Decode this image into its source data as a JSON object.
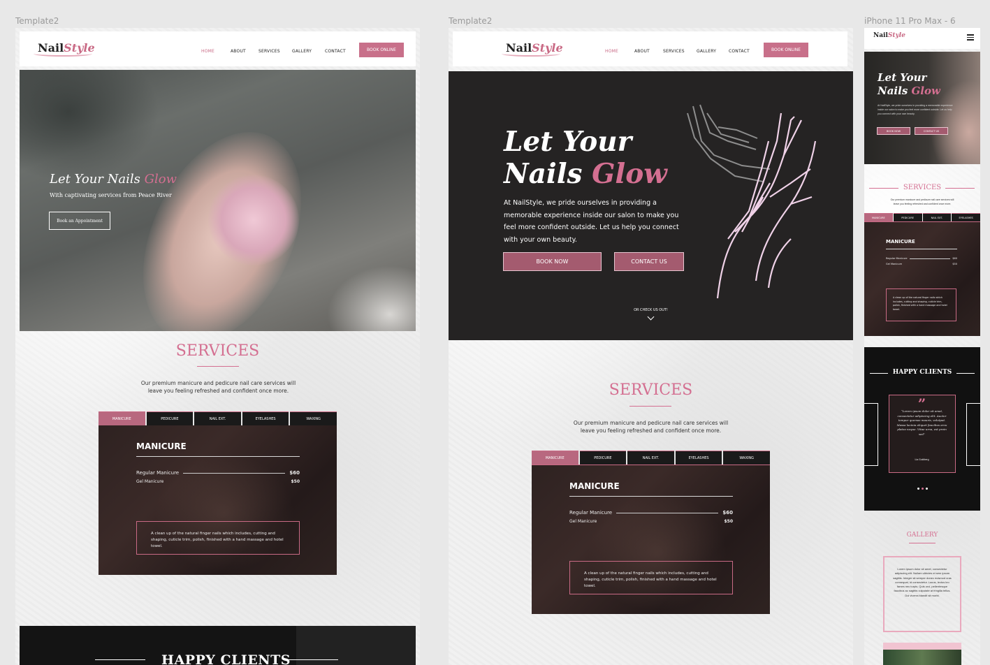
{
  "frames": {
    "f1_label": "Template2",
    "f2_label": "Template2",
    "f3_label": "iPhone 11 Pro Max - 6"
  },
  "brand": {
    "nail": "Nail",
    "style": "Style"
  },
  "nav": {
    "home": "HOME",
    "about": "ABOUT",
    "services": "SERVICES",
    "gallery": "GALLERY",
    "contact": "CONTACT",
    "book_online": "BOOK ONLINE"
  },
  "hero1": {
    "title_a": "Let Your Nails ",
    "title_b": "Glow",
    "subtitle": "With captivating services from Peace River",
    "button": "Book an Appointment"
  },
  "hero2": {
    "line1": "Let Your",
    "line2a": "Nails ",
    "line2b": "Glow",
    "paragraph": "At NailStyle, we pride ourselves in providing a memorable experience inside our salon to make you feel more confident outside. Let us help you connect with your own beauty.",
    "book_now": "BOOK NOW",
    "contact_us": "CONTACT US",
    "check_out": "OR CHECK US OUT!"
  },
  "services": {
    "title": "SERVICES",
    "text": "Our premium manicure and pedicure nail care services will leave you feeling refreshed and confident once more.",
    "tabs": [
      "MANICURE",
      "PEDICURE",
      "NAIL EXT.",
      "EYELASHES",
      "WAXING"
    ],
    "panel_title": "MANICURE",
    "item1": "Regular Manicure",
    "price1": "$60",
    "item2": "Gel Manicure",
    "price2": "$50",
    "description": "A clean up of the natural finger nails which includes, cutting and shaping, cuticle trim, polish, finished with a hand massage and hotel towel."
  },
  "clients": {
    "title": "HAPPY CLIENTS",
    "quote": "“Lorem ipsum dolor sit amet, consectetur adipiscing elit. Auctor tempor quemas mauris, volutpat. Massa lacinia aliquet faucibus arcu platea neque. Vitae urna, est proin sed”",
    "author": "Lia Goldberg"
  },
  "mobile": {
    "hero_line1": "Let Your",
    "hero_line2a": "Nails ",
    "hero_line2b": "Glow",
    "hero_text": "At NailStyle, we pride ourselves in providing a memorable experience inside our salon to make you feel more confident outside. Let us help you connect with your own beauty.",
    "book_now": "BOOK NOW",
    "contact_us": "CONTACT US",
    "services_text": "Our premium manicure and pedicure nail care services will leave you feeling refreshed and confident once more.",
    "tabs": [
      "MANICURE",
      "PEDICURE",
      "NAIL EXT.",
      "EYELASHES"
    ],
    "gallery_title": "GALLERY",
    "gallery_text": "Lorem ipsum dolor sit amet, consectetur adipiscing elit. Nullam ultricies et sem ipsum sagittis. Integer sit semper donec euismod cras consequat, id consectetur. Lacus, lectus leo fames nec turpis. Quis orci, pellentesque faucibus ac sagittis vulputate at fringilla tellus. Dui viverra blandit sit morbi."
  },
  "colors": {
    "accent": "#d46f91",
    "button": "#c8708a",
    "dark": "#252323"
  }
}
